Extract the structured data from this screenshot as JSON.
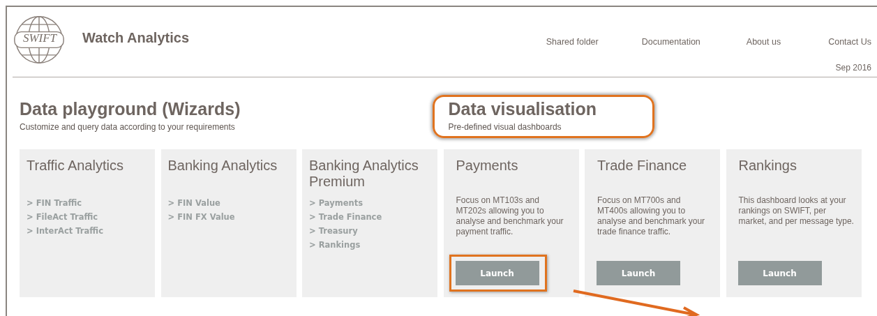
{
  "header": {
    "logo_text": "SWIFT",
    "title": "Watch Analytics",
    "nav": [
      "Shared folder",
      "Documentation",
      "About us",
      "Contact Us"
    ],
    "date": "Sep 2016"
  },
  "sections": [
    {
      "title": "Data playground (Wizards)",
      "subtitle": "Customize and query data according to your requirements",
      "highlighted": false
    },
    {
      "title": "Data visualisation",
      "subtitle": "Pre-defined visual dashboards",
      "highlighted": true
    }
  ],
  "cards": [
    {
      "kind": "wizard",
      "title": "Traffic Analytics",
      "links": [
        "> FIN Traffic",
        "> FileAct Traffic",
        "> InterAct Traffic"
      ]
    },
    {
      "kind": "wizard",
      "title": "Banking Analytics",
      "links": [
        "> FIN Value",
        "> FIN FX Value"
      ]
    },
    {
      "kind": "wizard",
      "title": "Banking Analytics Premium",
      "links": [
        "> Payments",
        "> Trade Finance",
        "> Treasury",
        "> Rankings"
      ]
    },
    {
      "kind": "dashboard",
      "title": "Payments",
      "description": "Focus on MT103s and MT202s allowing you to analyse and benchmark your payment traffic.",
      "button": "Launch",
      "highlighted": true
    },
    {
      "kind": "dashboard",
      "title": "Trade Finance",
      "description": "Focus on MT700s and MT400s allowing you to analyse and benchmark your trade finance traffic.",
      "button": "Launch",
      "highlighted": false
    },
    {
      "kind": "dashboard",
      "title": "Rankings",
      "description": "This dashboard looks at your rankings on SWIFT, per market, and per message type.",
      "button": "Launch",
      "highlighted": false
    }
  ]
}
